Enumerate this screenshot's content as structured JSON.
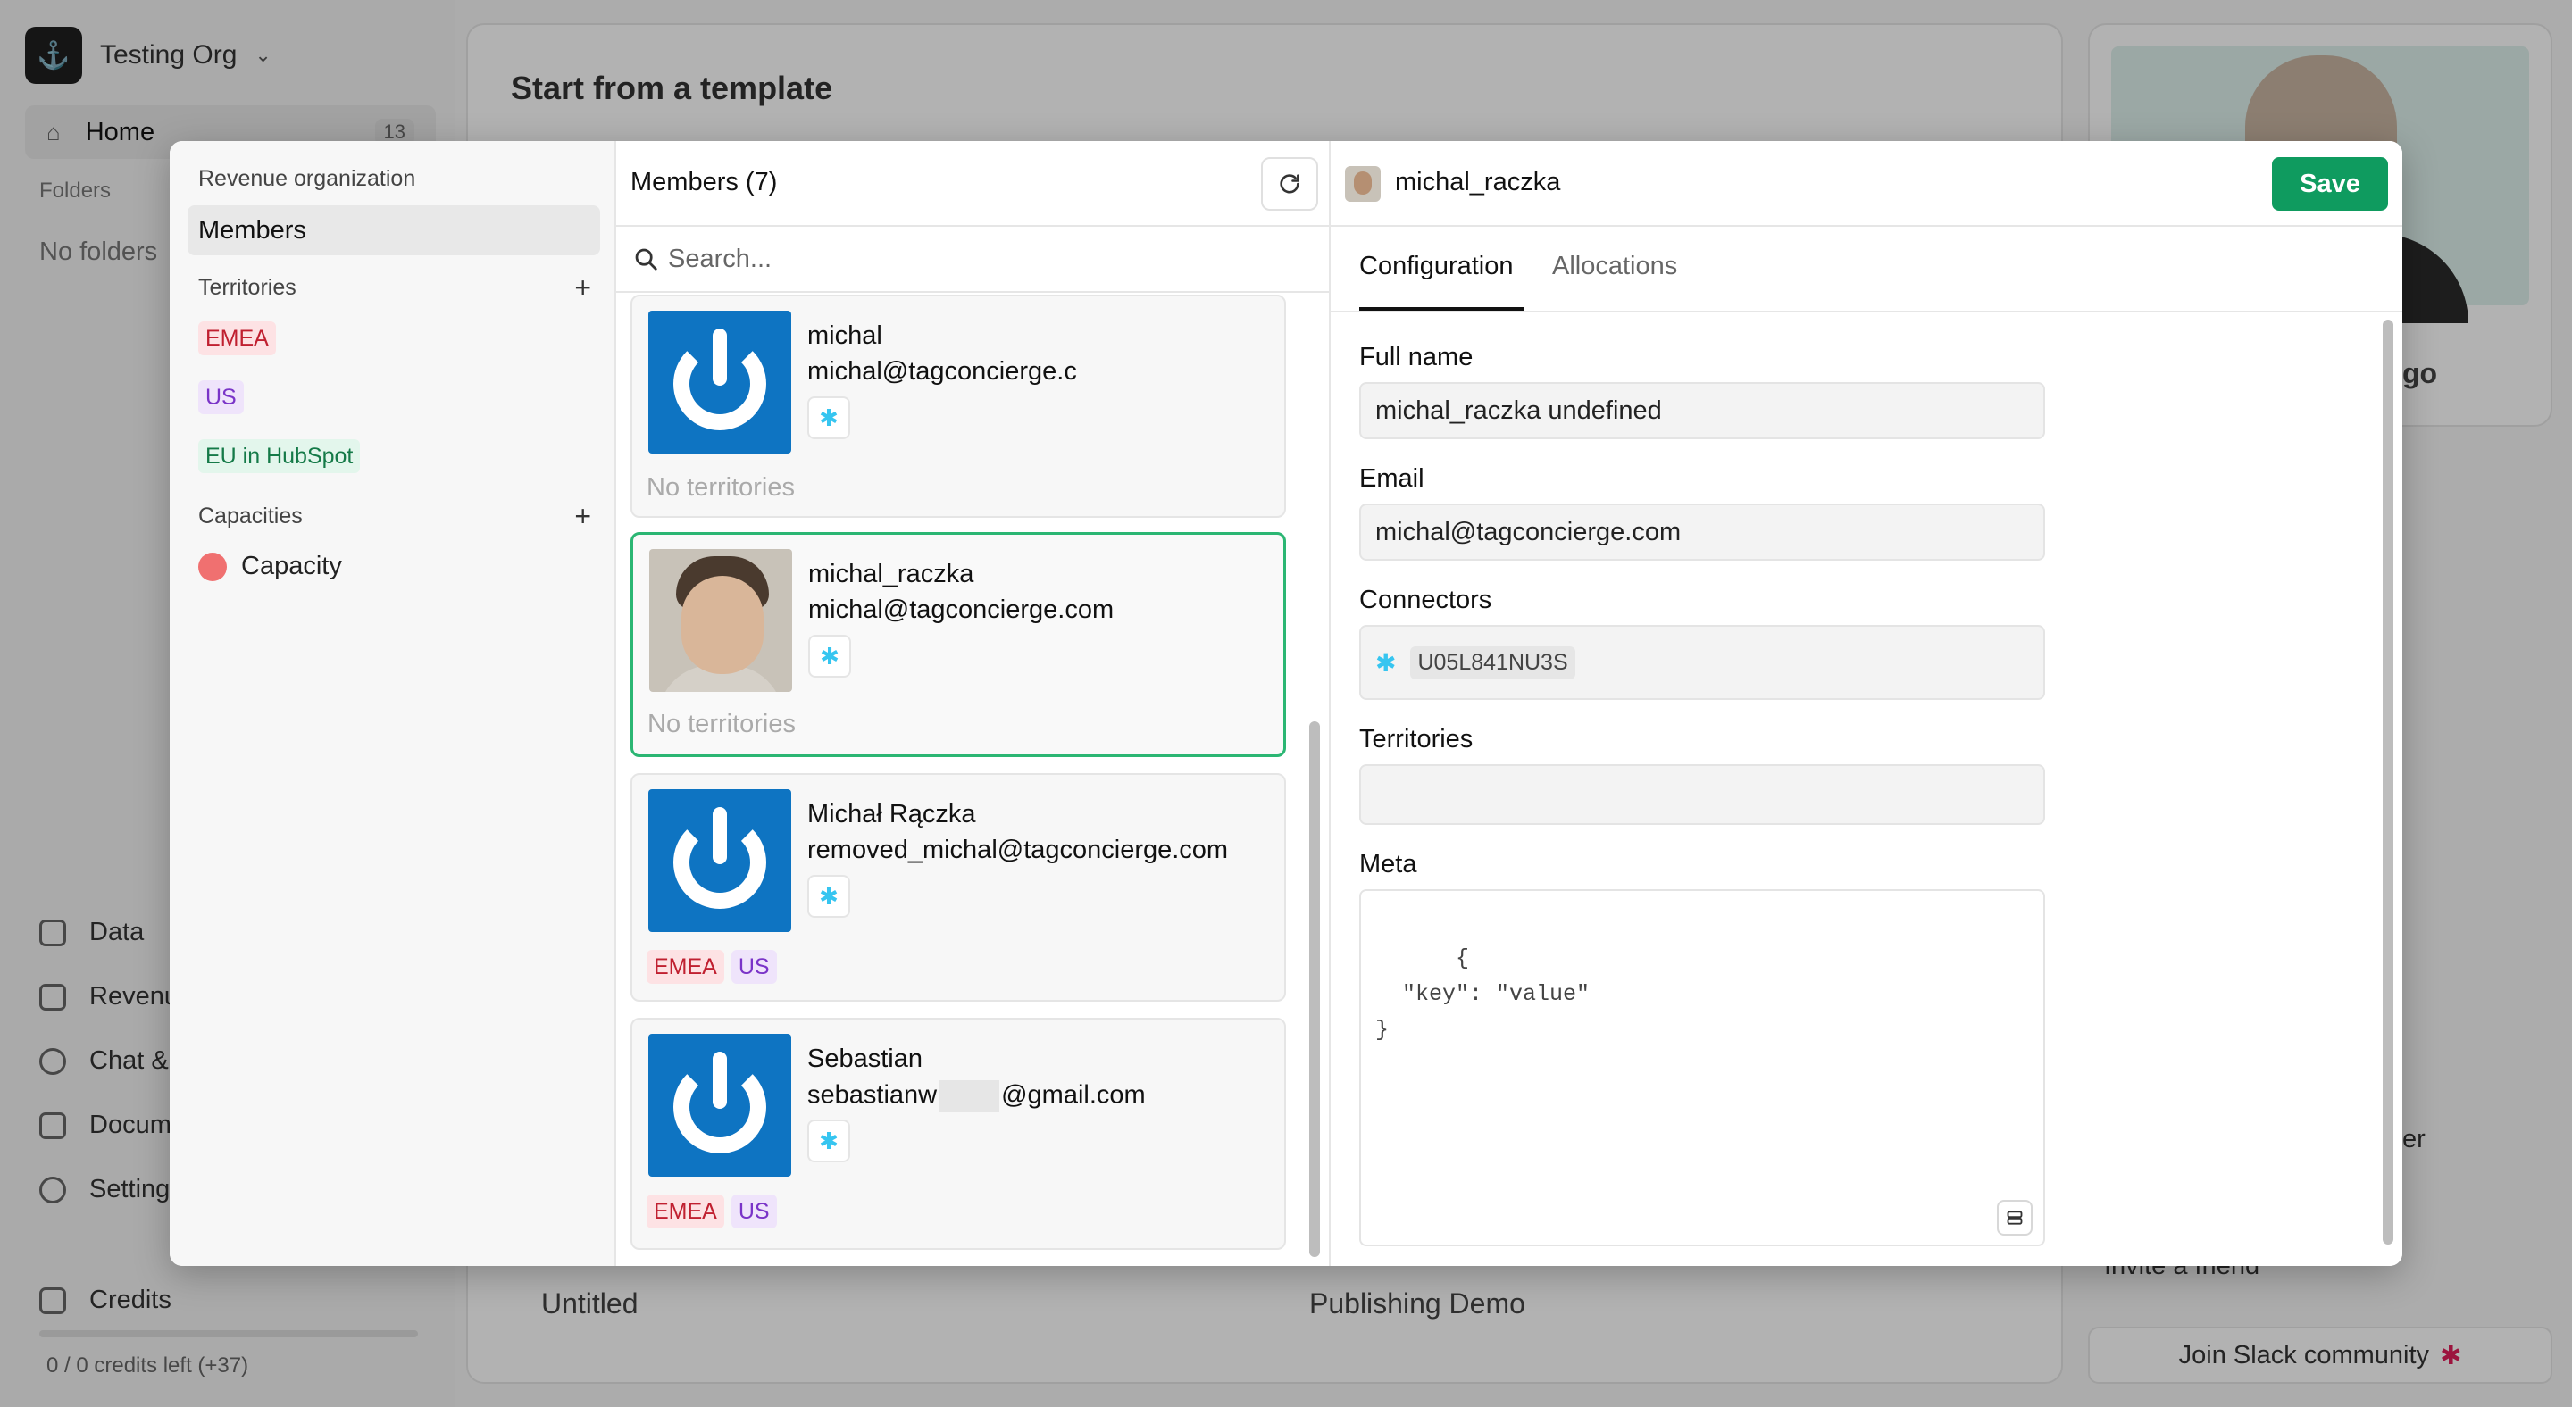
{
  "background": {
    "org_name": "Testing Org",
    "home": {
      "label": "Home",
      "count": "13"
    },
    "folders_label": "Folders",
    "no_folders": "No folders",
    "nav": [
      "Data",
      "Revenu",
      "Chat &",
      "Docum",
      "Setting"
    ],
    "credits": {
      "label": "Credits",
      "left": "0 / 0 credits left (+37)"
    },
    "main_title": "Start from a template",
    "cards": [
      "Untitled",
      "Publishing Demo"
    ],
    "right_snippet": "go",
    "right_er": "er",
    "invite": "Invite a friend",
    "slack_community": "Join Slack community"
  },
  "modal": {
    "left": {
      "org_title": "Revenue organization",
      "members_label": "Members",
      "territories_label": "Territories",
      "territories": [
        {
          "label": "EMEA",
          "color": "#c02030"
        },
        {
          "label": "US",
          "color": "#7a34c8"
        },
        {
          "label": "EU in HubSpot",
          "color": "#157a48"
        }
      ],
      "capacities_label": "Capacities",
      "capacities": [
        {
          "label": "Capacity",
          "color": "#f07070"
        }
      ]
    },
    "middle": {
      "title": "Members (7)",
      "search_placeholder": "Search...",
      "members": [
        {
          "name": "michal",
          "email": "michal@tagconcierge.c",
          "territories_text": "No territories",
          "avatar": "power-icon"
        },
        {
          "name": "michal_raczka",
          "email": "michal@tagconcierge.com",
          "territories_text": "No territories",
          "avatar": "photo",
          "selected": true
        },
        {
          "name": "Michał Rączka",
          "email": "removed_michal@tagconcierge.com",
          "tags": [
            "EMEA",
            "US"
          ],
          "avatar": "power-icon"
        },
        {
          "name": "Sebastian",
          "email_prefix": "sebastianw",
          "email_suffix": "@gmail.com",
          "tags": [
            "EMEA",
            "US"
          ],
          "avatar": "power-icon"
        }
      ]
    },
    "right": {
      "member_name": "michal_raczka",
      "save_label": "Save",
      "tabs": [
        "Configuration",
        "Allocations"
      ],
      "full_name_label": "Full name",
      "full_name_value": "michal_raczka undefined",
      "email_label": "Email",
      "email_value": "michal@tagconcierge.com",
      "connectors_label": "Connectors",
      "connector_id": "U05L841NU3S",
      "territories_label": "Territories",
      "meta_label": "Meta",
      "meta_value": "{\n  \"key\": \"value\"\n}"
    }
  },
  "colors": {
    "accent": "#0f9b5f",
    "selected_border": "#2bb673",
    "avatar_blue": "#0e74c2"
  }
}
